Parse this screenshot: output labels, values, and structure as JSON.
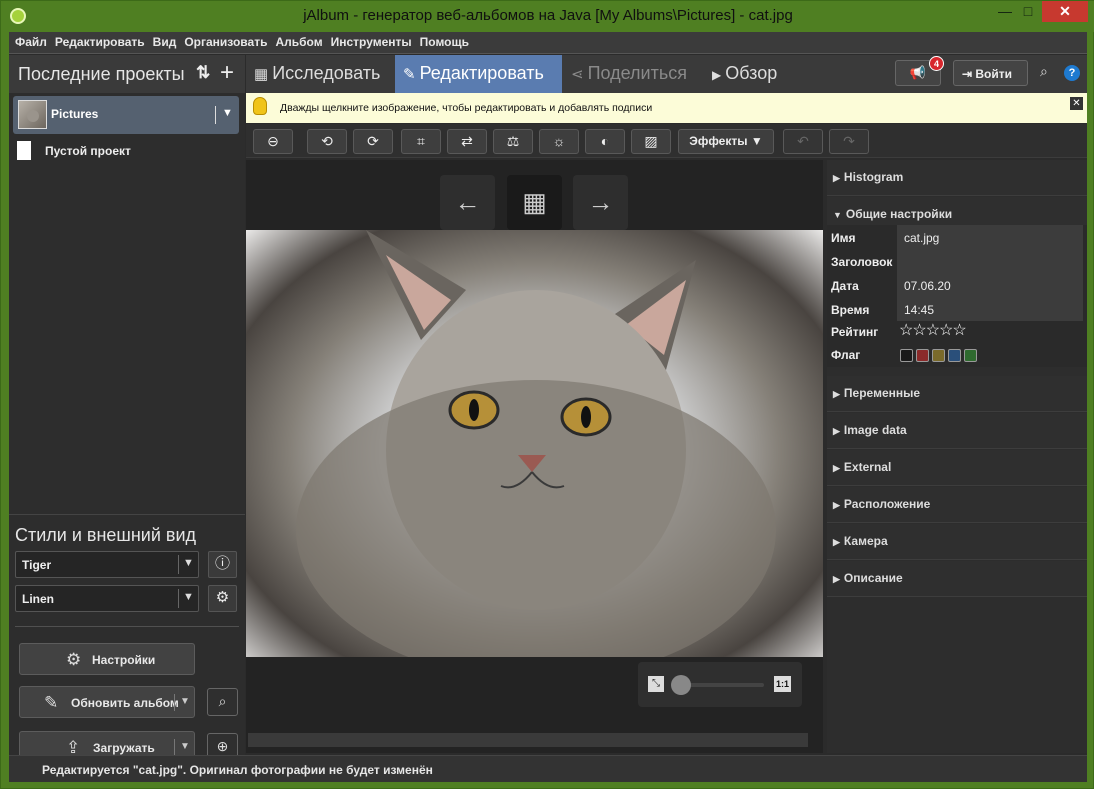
{
  "window": {
    "title": "jAlbum - генератор веб-альбомов на Java [My Albums\\Pictures] - cat.jpg",
    "min_glyph": "—",
    "max_glyph": "□",
    "close_glyph": "✕"
  },
  "menu": [
    "Файл",
    "Редактировать",
    "Вид",
    "Организовать",
    "Альбом",
    "Инструменты",
    "Помощь"
  ],
  "left_panel": {
    "title": "Последние проекты",
    "sort_glyph": "⇅",
    "add_glyph": "+",
    "projects": [
      {
        "name": "Pictures",
        "selected": true
      },
      {
        "name": "Пустой проект",
        "selected": false
      }
    ],
    "styles_title": "Стили и внешний вид",
    "style_value": "Tiger",
    "skin_value": "Linen",
    "settings_label": "Настройки",
    "update_label": "Обновить альбом",
    "upload_label": "Загружать"
  },
  "tabs": [
    {
      "label": "Исследовать",
      "icon": "grid-icon",
      "glyph": "▦"
    },
    {
      "label": "Редактировать",
      "icon": "pencil-icon",
      "glyph": "✎"
    },
    {
      "label": "Поделиться",
      "icon": "share-icon",
      "glyph": "⋖"
    },
    {
      "label": "Обзор",
      "icon": "play-icon",
      "glyph": "▶"
    }
  ],
  "header_right": {
    "notifications": 4,
    "login_label": "Войти",
    "help_glyph": "?"
  },
  "hint": {
    "text": "Дважды щелкните изображение, чтобы редактировать и добавлять подписи",
    "close_glyph": "✕"
  },
  "edit_toolbar": {
    "effects_label": "Эффекты",
    "tools": [
      "remove-icon",
      "rotate-left-icon",
      "rotate-right-icon",
      "crop-icon",
      "flip-icon",
      "straighten-icon",
      "brightness-icon",
      "contrast-icon",
      "image-adjust-icon"
    ]
  },
  "viewer": {
    "prev_glyph": "←",
    "grid_glyph": "▦",
    "next_glyph": "→",
    "zoom_label": "1:1"
  },
  "right_panel": {
    "sections": [
      "Histogram",
      "Общие настройки",
      "Переменные",
      "Image data",
      "External",
      "Расположение",
      "Камера",
      "Описание"
    ],
    "fields": {
      "name_label": "Имя",
      "name_value": "cat.jpg",
      "title_label": "Заголовок",
      "title_value": "",
      "date_label": "Дата",
      "date_value": "07.06.20",
      "time_label": "Время",
      "time_value": "14:45",
      "rating_label": "Рейтинг",
      "rating": 0,
      "flag_label": "Флаг",
      "flag_colors": [
        "#1a1a1a",
        "#8b2a2a",
        "#7a6a2a",
        "#2a4f7a",
        "#2f6a2f"
      ]
    }
  },
  "status": {
    "text": "Редактируется \"cat.jpg\". Оригинал фотографии не будет изменён"
  }
}
